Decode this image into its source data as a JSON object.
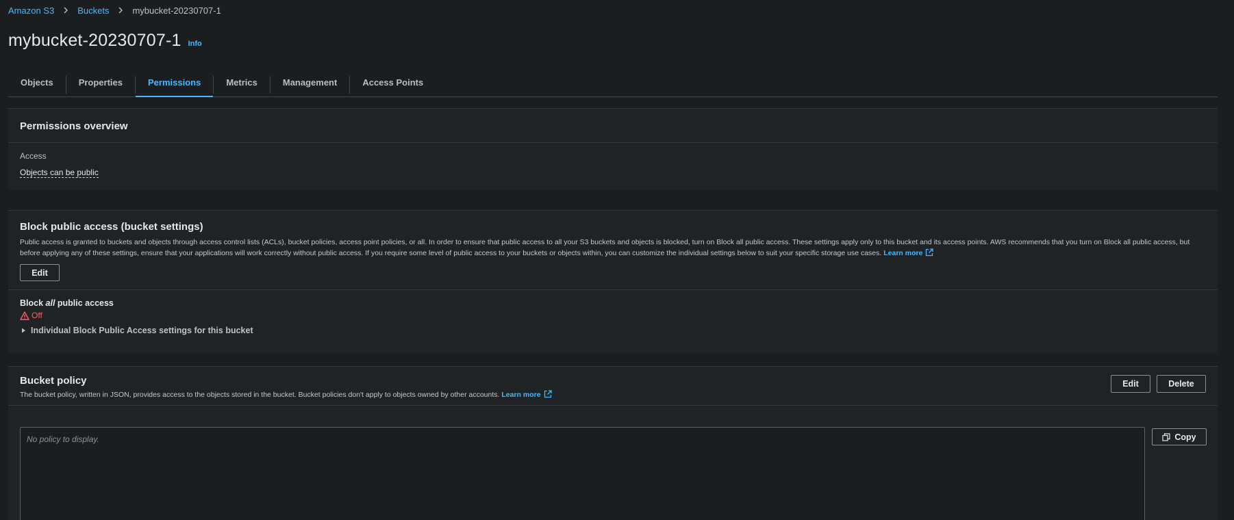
{
  "breadcrumb": {
    "items": [
      "Amazon S3",
      "Buckets"
    ],
    "current": "mybucket-20230707-1"
  },
  "page": {
    "title": "mybucket-20230707-1",
    "info_label": "Info"
  },
  "tabs": [
    {
      "label": "Objects",
      "active": false
    },
    {
      "label": "Properties",
      "active": false
    },
    {
      "label": "Permissions",
      "active": true
    },
    {
      "label": "Metrics",
      "active": false
    },
    {
      "label": "Management",
      "active": false
    },
    {
      "label": "Access Points",
      "active": false
    }
  ],
  "permissions_overview": {
    "title": "Permissions overview",
    "access_label": "Access",
    "access_value": "Objects can be public"
  },
  "block_public_access": {
    "title": "Block public access (bucket settings)",
    "description": "Public access is granted to buckets and objects through access control lists (ACLs), bucket policies, access point policies, or all. In order to ensure that public access to all your S3 buckets and objects is blocked, turn on Block all public access. These settings apply only to this bucket and its access points. AWS recommends that you turn on Block all public access, but before applying any of these settings, ensure that your applications will work correctly without public access. If you require some level of public access to your buckets or objects within, you can customize the individual settings below to suit your specific storage use cases.",
    "learn_more": "Learn more",
    "edit_label": "Edit",
    "block_all_prefix": "Block ",
    "block_all_emph": "all",
    "block_all_suffix": " public access",
    "status": "Off",
    "expander_label": "Individual Block Public Access settings for this bucket"
  },
  "bucket_policy": {
    "title": "Bucket policy",
    "description": "The bucket policy, written in JSON, provides access to the objects stored in the bucket. Bucket policies don't apply to objects owned by other accounts.",
    "learn_more": "Learn more",
    "edit_label": "Edit",
    "delete_label": "Delete",
    "empty_text": "No policy to display.",
    "copy_label": "Copy"
  },
  "colors": {
    "accent": "#44b9ff",
    "warning": "#ff5d64",
    "background": "#1b1e21",
    "panel": "#1f2326"
  },
  "icons": {
    "breadcrumb_separator": "chevron-right-icon",
    "external_link": "external-link-icon",
    "warning": "warning-icon",
    "expander": "caret-right-icon",
    "copy": "copy-icon"
  }
}
